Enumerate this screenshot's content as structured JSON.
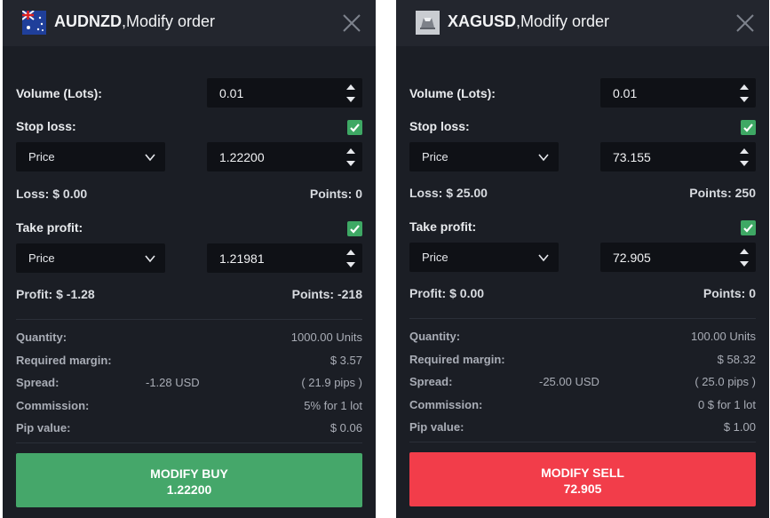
{
  "left": {
    "symbol": "AUDNZD",
    "title_suffix": ",Modify order",
    "volume_label": "Volume (Lots):",
    "volume_value": "0.01",
    "stop_loss_label": "Stop loss:",
    "stop_loss_type": "Price",
    "stop_loss_value": "1.22200",
    "loss_text": "Loss: $ 0.00",
    "loss_points": "Points: 0",
    "take_profit_label": "Take profit:",
    "take_profit_type": "Price",
    "take_profit_value": "1.21981",
    "profit_text": "Profit: $ -1.28",
    "profit_points": "Points: -218",
    "quantity_label": "Quantity:",
    "quantity_value": "1000.00 Units",
    "margin_label": "Required margin:",
    "margin_value": "$ 3.57",
    "spread_label": "Spread:",
    "spread_usd": "-1.28 USD",
    "spread_pips": "( 21.9 pips )",
    "commission_label": "Commission:",
    "commission_value": "5% for 1 lot",
    "pip_label": "Pip value:",
    "pip_value": "$ 0.06",
    "button_label": "MODIFY BUY",
    "button_price": "1.22200",
    "button_color": "#45a76a"
  },
  "right": {
    "symbol": "XAGUSD",
    "title_suffix": ",Modify order",
    "volume_label": "Volume (Lots):",
    "volume_value": "0.01",
    "stop_loss_label": "Stop loss:",
    "stop_loss_type": "Price",
    "stop_loss_value": "73.155",
    "loss_text": "Loss: $ 25.00",
    "loss_points": "Points: 250",
    "take_profit_label": "Take profit:",
    "take_profit_type": "Price",
    "take_profit_value": "72.905",
    "profit_text": "Profit: $ 0.00",
    "profit_points": "Points: 0",
    "quantity_label": "Quantity:",
    "quantity_value": "100.00 Units",
    "margin_label": "Required margin:",
    "margin_value": "$ 58.32",
    "spread_label": "Spread:",
    "spread_usd": "-25.00 USD",
    "spread_pips": "( 25.0 pips )",
    "commission_label": "Commission:",
    "commission_value": "0 $ for 1 lot",
    "pip_label": "Pip value:",
    "pip_value": "$ 1.00",
    "button_label": "MODIFY SELL",
    "button_price": "72.905",
    "button_color": "#f23d4a"
  },
  "colors": {
    "panel_bg": "#1b1e25",
    "input_bg": "#0f1116",
    "check_green": "#3ea864"
  }
}
